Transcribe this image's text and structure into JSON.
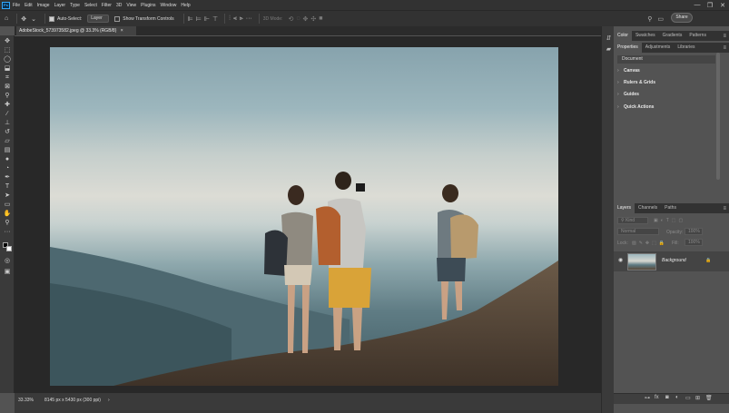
{
  "app": {
    "logo_text": "Ps"
  },
  "menu": [
    "File",
    "Edit",
    "Image",
    "Layer",
    "Type",
    "Select",
    "Filter",
    "3D",
    "View",
    "Plugins",
    "Window",
    "Help"
  ],
  "window_controls": [
    "—",
    "❐",
    "✕"
  ],
  "options": {
    "auto_select_label": "Auto-Select:",
    "auto_select_value": "Layer",
    "transform_label": "Show Transform Controls",
    "mode_3d_label": "3D Mode:"
  },
  "share_label": "Share",
  "document_tab": {
    "title": "AdobeStock_573973582.jpeg @ 33.3% (RGB/8)",
    "close": "×"
  },
  "status": {
    "zoom": "33.33%",
    "dimensions": "8145 px x 5430 px (300 ppi)",
    "arrow": "›"
  },
  "panels": {
    "top_tabs": [
      "Color",
      "Swatches",
      "Gradients",
      "Patterns"
    ],
    "mid_tabs": [
      "Properties",
      "Adjustments",
      "Libraries"
    ],
    "doc_label": "Document",
    "sections": [
      "Canvas",
      "Rulers & Grids",
      "Guides",
      "Quick Actions"
    ],
    "layer_tabs": [
      "Layers",
      "Channels",
      "Paths"
    ],
    "kind_placeholder": "Kind",
    "blend_mode": "Normal",
    "opacity_label": "Opacity:",
    "opacity_value": "100%",
    "lock_label": "Lock:",
    "fill_label": "Fill:",
    "fill_value": "100%",
    "layer_name": "Background"
  },
  "icons": {
    "home": "⌂",
    "move": "✥",
    "dropdown": "⌄",
    "more": "···",
    "search": "⚲",
    "workspace": "▭",
    "menu": "≡",
    "chevron": "›",
    "eye": "◉",
    "lock": "🔒"
  }
}
